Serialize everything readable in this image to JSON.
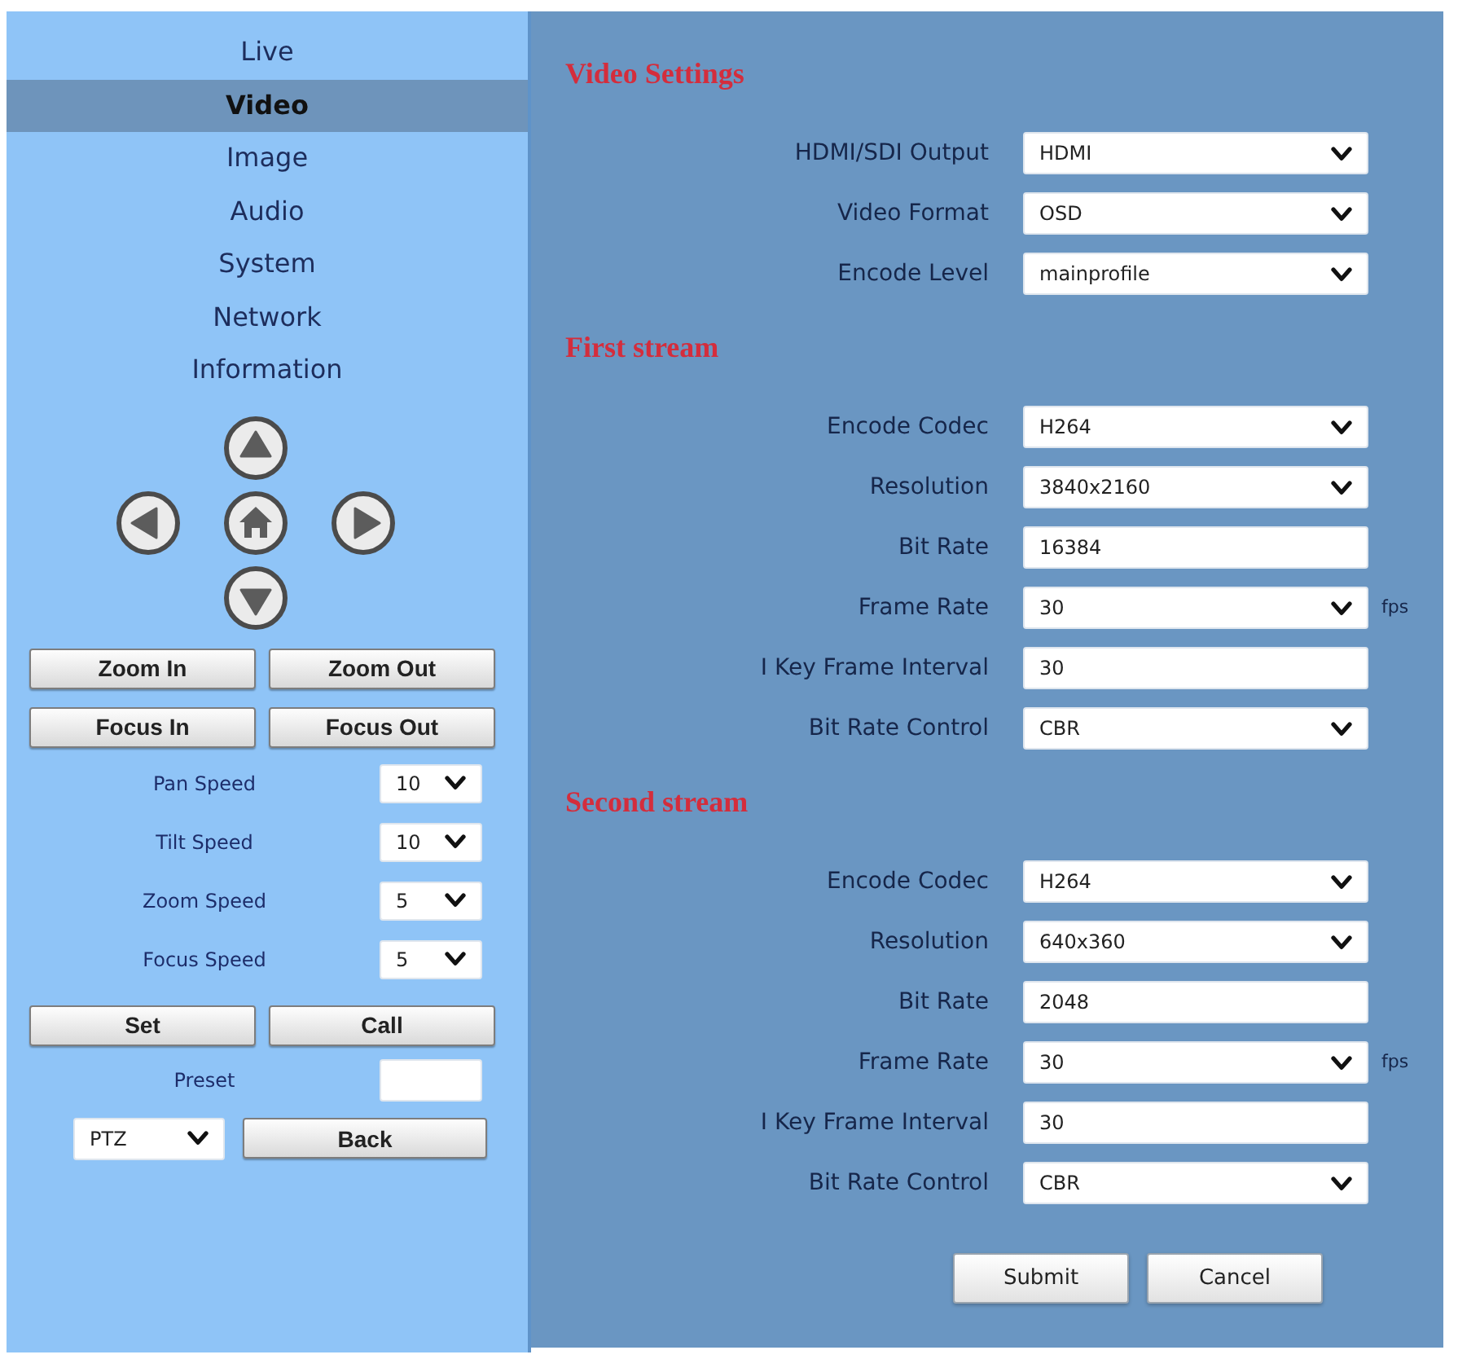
{
  "sidebar": {
    "menu": [
      {
        "label": "Live",
        "selected": false
      },
      {
        "label": "Video",
        "selected": true
      },
      {
        "label": "Image",
        "selected": false
      },
      {
        "label": "Audio",
        "selected": false
      },
      {
        "label": "System",
        "selected": false
      },
      {
        "label": "Network",
        "selected": false
      },
      {
        "label": "Information",
        "selected": false
      }
    ]
  },
  "ptz": {
    "lens_buttons": [
      "Zoom In",
      "Zoom Out",
      "Focus In",
      "Focus Out"
    ],
    "speeds": [
      {
        "label": "Pan Speed",
        "value": "10"
      },
      {
        "label": "Tilt Speed",
        "value": "10"
      },
      {
        "label": "Zoom Speed",
        "value": "5"
      },
      {
        "label": "Focus Speed",
        "value": "5"
      }
    ],
    "preset_buttons": [
      "Set",
      "Call"
    ],
    "preset": {
      "label": "Preset"
    },
    "mode": {
      "value": "PTZ"
    },
    "back_button": "Back"
  },
  "settings": {
    "sections": [
      {
        "title": "Video Settings",
        "fields": [
          {
            "label": "HDMI/SDI Output",
            "kind": "select",
            "value": "HDMI"
          },
          {
            "label": "Video Format",
            "kind": "select",
            "value": "OSD"
          },
          {
            "label": "Encode Level",
            "kind": "select",
            "value": "mainprofile"
          }
        ]
      },
      {
        "title": "First stream",
        "fields": [
          {
            "label": "Encode Codec",
            "kind": "select",
            "value": "H264"
          },
          {
            "label": "Resolution",
            "kind": "select",
            "value": "3840x2160"
          },
          {
            "label": "Bit Rate",
            "kind": "text",
            "value": "16384"
          },
          {
            "label": "Frame Rate",
            "kind": "select",
            "value": "30",
            "unit": "fps"
          },
          {
            "label": "I Key Frame Interval",
            "kind": "text",
            "value": "30"
          },
          {
            "label": "Bit Rate Control",
            "kind": "select",
            "value": "CBR"
          }
        ]
      },
      {
        "title": "Second stream",
        "fields": [
          {
            "label": "Encode Codec",
            "kind": "select",
            "value": "H264"
          },
          {
            "label": "Resolution",
            "kind": "select",
            "value": "640x360"
          },
          {
            "label": "Bit Rate",
            "kind": "text",
            "value": "2048"
          },
          {
            "label": "Frame Rate",
            "kind": "select",
            "value": "30",
            "unit": "fps"
          },
          {
            "label": "I Key Frame Interval",
            "kind": "text",
            "value": "30"
          },
          {
            "label": "Bit Rate Control",
            "kind": "select",
            "value": "CBR"
          }
        ]
      }
    ],
    "buttons": [
      "Submit",
      "Cancel"
    ]
  }
}
